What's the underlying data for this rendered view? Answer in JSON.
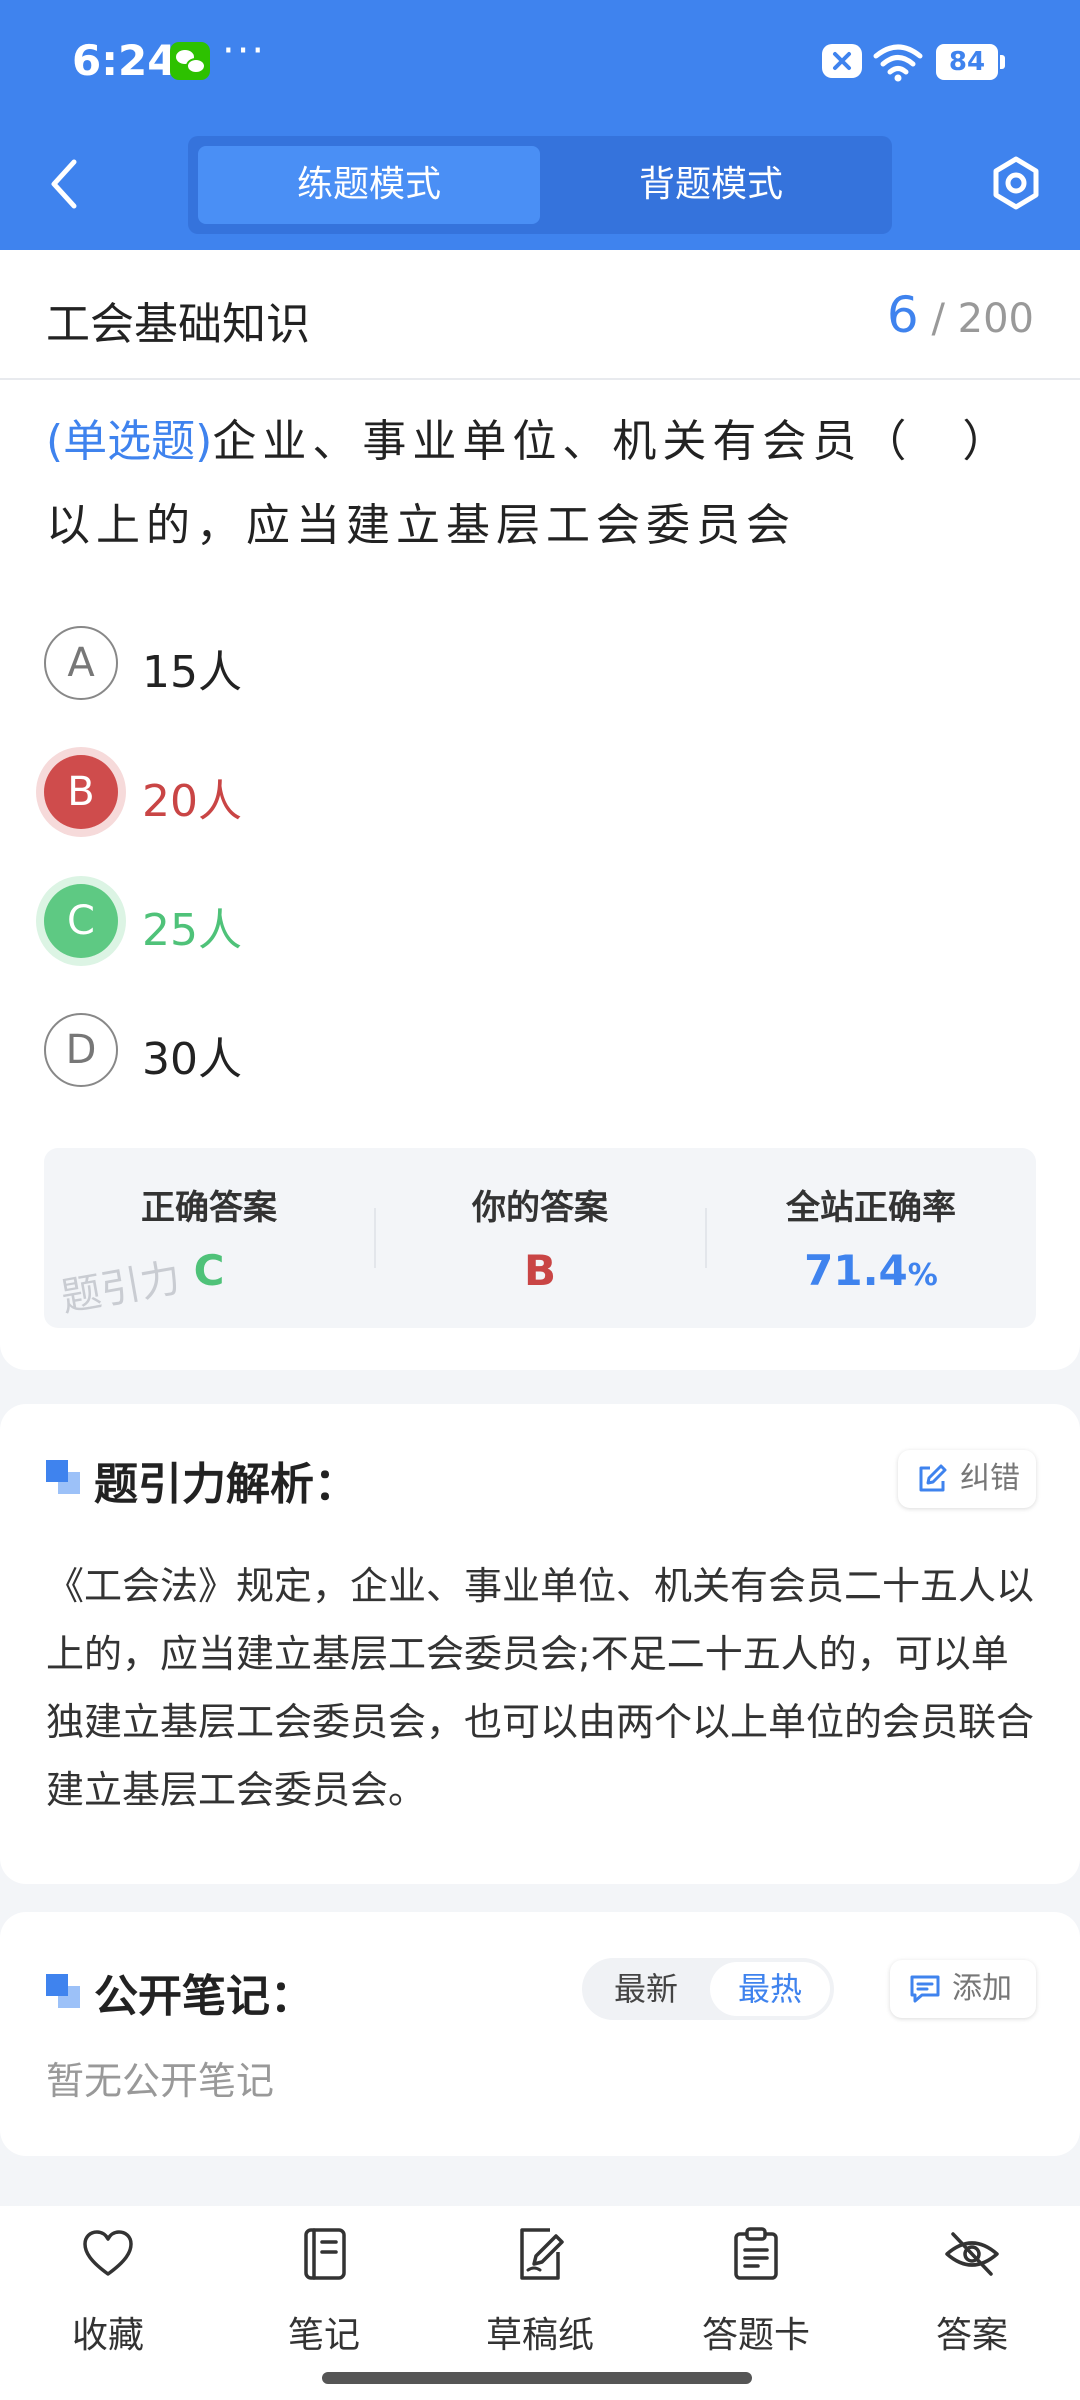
{
  "status": {
    "time": "6:24",
    "battery": "84"
  },
  "header": {
    "tab_practice": "练题模式",
    "tab_memorize": "背题模式"
  },
  "subject": {
    "title": "工会基础知识",
    "current": "6",
    "total": "/ 200"
  },
  "question": {
    "type": "(单选题)",
    "text": "企业、事业单位、机关有会员（　）以上的，应当建立基层工会委员会",
    "options": [
      {
        "letter": "A",
        "text": "15人"
      },
      {
        "letter": "B",
        "text": "20人"
      },
      {
        "letter": "C",
        "text": "25人"
      },
      {
        "letter": "D",
        "text": "30人"
      }
    ]
  },
  "answer": {
    "correct_label": "正确答案",
    "correct_value": "C",
    "yours_label": "你的答案",
    "yours_value": "B",
    "rate_label": "全站正确率",
    "rate_value": "71.4",
    "rate_unit": "%",
    "watermark": "题引力"
  },
  "analysis": {
    "title": "题引力解析：",
    "report_label": "纠错",
    "text": "《工会法》规定，企业、事业单位、机关有会员二十五人以上的，应当建立基层工会委员会;不足二十五人的，可以单独建立基层工会委员会，也可以由两个以上单位的会员联合建立基层工会委员会。"
  },
  "notes": {
    "title": "公开笔记：",
    "sort_new": "最新",
    "sort_hot": "最热",
    "add_label": "添加",
    "empty_text": "暂无公开笔记"
  },
  "bottom_bar": {
    "favorite": "收藏",
    "notes": "笔记",
    "scratch": "草稿纸",
    "answer_card": "答题卡",
    "answer": "答案"
  },
  "colors": {
    "primary": "#3f83ee",
    "wrong": "#cf4c4c",
    "right": "#5ec983"
  }
}
